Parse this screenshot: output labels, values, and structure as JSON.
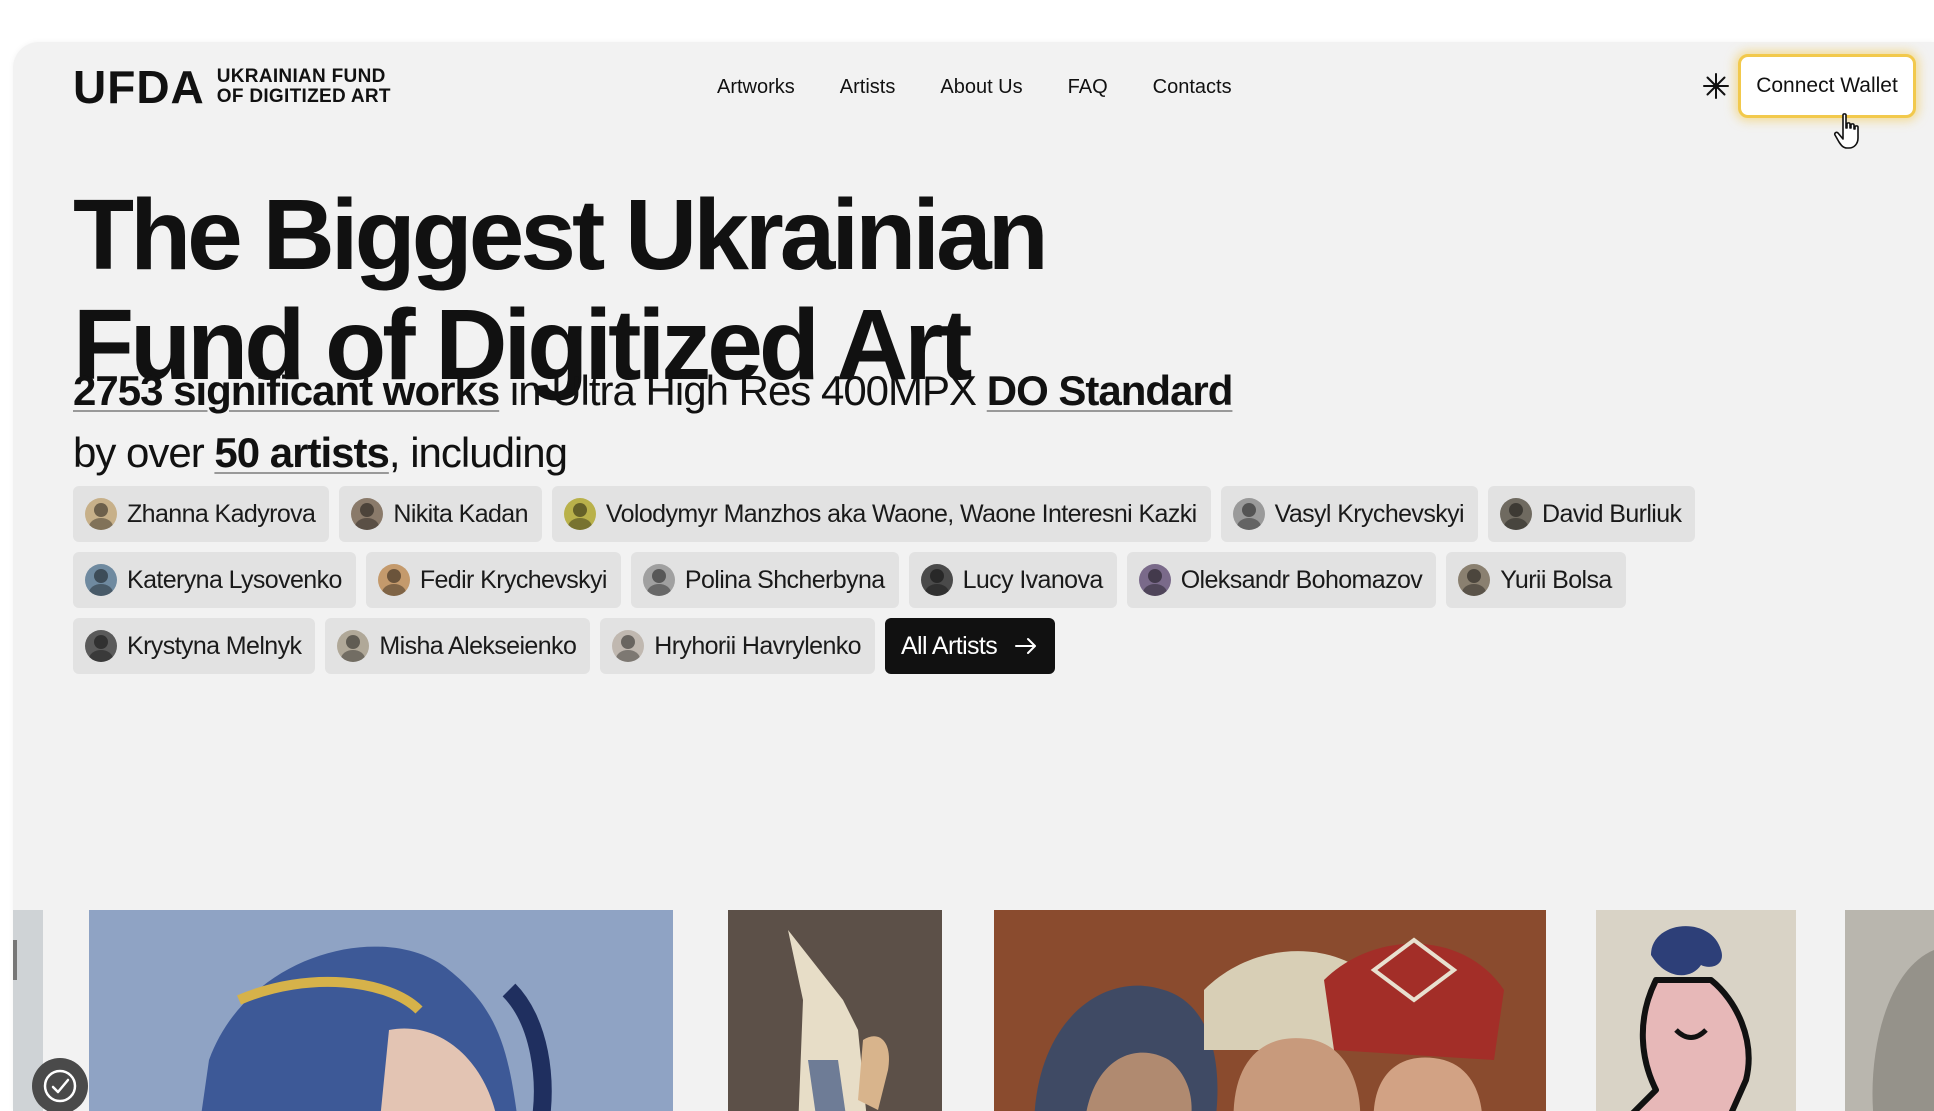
{
  "header": {
    "logo_mark": "UFDA",
    "logo_line1": "UKRAINIAN FUND",
    "logo_line2": "OF DIGITIZED ART",
    "nav": [
      "Artworks",
      "Artists",
      "About Us",
      "FAQ",
      "Contacts"
    ],
    "theme_icon": "sun-icon",
    "connect_label": "Connect Wallet",
    "accent_color": "#f2c94c"
  },
  "hero": {
    "headline_line1": "The Biggest Ukrainian",
    "headline_line2": "Fund of Digitized Art",
    "sub_works": "2753 significant works",
    "sub_mid": " in Ultra High Res 400MPX ",
    "sub_standard": "DO Standard",
    "sub_by": "by over ",
    "sub_artists": "50 artists",
    "sub_tail": ", including"
  },
  "artists": {
    "rows": [
      [
        {
          "name": "Zhanna Kadyrova",
          "avatar": "#c7b089"
        },
        {
          "name": "Nikita Kadan",
          "avatar": "#8a7a6a"
        },
        {
          "name": "Volodymyr Manzhos aka Waone, Waone Interesni Kazki",
          "avatar": "#b9b14a"
        },
        {
          "name": "Vasyl Krychevskyi",
          "avatar": "#9a9a9a"
        },
        {
          "name": "David Burliuk",
          "avatar": "#6f6a60"
        }
      ],
      [
        {
          "name": "Kateryna Lysovenko",
          "avatar": "#6f8aa0"
        },
        {
          "name": "Fedir Krychevskyi",
          "avatar": "#c49a6c"
        },
        {
          "name": "Polina Shcherbyna",
          "avatar": "#a0a0a0"
        },
        {
          "name": "Lucy Ivanova",
          "avatar": "#4a4a4a"
        },
        {
          "name": "Oleksandr Bohomazov",
          "avatar": "#7a6a8a"
        },
        {
          "name": "Yurii Bolsa",
          "avatar": "#8a8070"
        }
      ],
      [
        {
          "name": "Krystyna Melnyk",
          "avatar": "#5a5a5a"
        },
        {
          "name": "Misha Alekseienko",
          "avatar": "#b0a898"
        },
        {
          "name": "Hryhorii Havrylenko",
          "avatar": "#c0b8b0"
        }
      ]
    ],
    "all_label": "All Artists"
  },
  "gallery": {
    "artworks": [
      {
        "name": "artwork-edge-left",
        "color": "#cfd3d6"
      },
      {
        "name": "artwork-pointillist-portrait",
        "color": "#8fa3c4"
      },
      {
        "name": "artwork-figure-with-child",
        "color": "#5c5048"
      },
      {
        "name": "artwork-women-in-headscarves",
        "color": "#8a4b2e"
      },
      {
        "name": "artwork-seated-nude-sketch",
        "color": "#d9d3c6"
      },
      {
        "name": "artwork-edge-right",
        "color": "#b9b6ae"
      }
    ]
  },
  "widget_icon": "accessibility-icon"
}
